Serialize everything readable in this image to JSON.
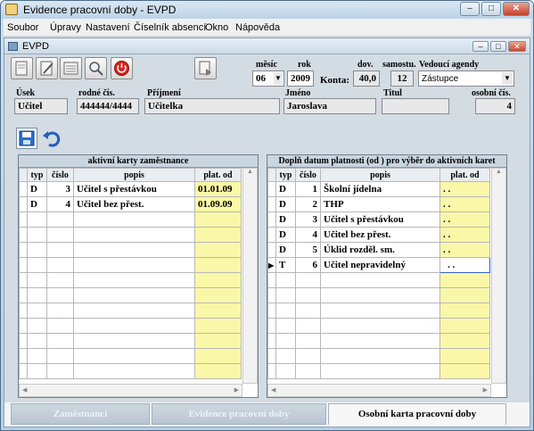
{
  "window": {
    "title": "Evidence pracovní doby - EVPD",
    "min": "–",
    "max": "□",
    "close": "✕"
  },
  "menu": [
    "Soubor",
    "Úpravy",
    "Nastavení",
    "Číselník absencí",
    "Okno",
    "Nápověda"
  ],
  "inner": {
    "title": "EVPD"
  },
  "header": {
    "mesic_label": "měsíc",
    "mesic": "06",
    "rok_label": "rok",
    "rok": "2009",
    "konta_label": "Konta:",
    "dov_label": "dov.",
    "dov": "40,0",
    "samostu_label": "samostu.",
    "samostu": "12",
    "vedouci_label": "Vedoucí agendy",
    "vedouci": "Zástupce"
  },
  "person": {
    "usek_label": "Úsek",
    "usek": "Učitel",
    "rc_label": "rodné čís.",
    "rc": "444444/4444",
    "prijmeni_label": "Příjmení",
    "prijmeni": "Učitelka",
    "jmeno_label": "Jméno",
    "jmeno": "Jaroslava",
    "titul_label": "Titul",
    "titul": "",
    "osobni_label": "osobní čís.",
    "osobni": "4"
  },
  "left_grid": {
    "title": "aktivní karty zaměstnance",
    "cols": [
      "typ",
      "číslo",
      "popis",
      "plat. od"
    ],
    "rows": [
      {
        "typ": "D",
        "cislo": "3",
        "popis": "Učitel s přestávkou",
        "plat": "01.01.09"
      },
      {
        "typ": "D",
        "cislo": "4",
        "popis": "Učitel bez přest.",
        "plat": "01.09.09"
      }
    ]
  },
  "right_grid": {
    "title": "Doplň datum platnosti (od ) pro výběr do aktivních karet",
    "cols": [
      "typ",
      "číslo",
      "popis",
      "plat. od"
    ],
    "rows": [
      {
        "typ": "D",
        "cislo": "1",
        "popis": "Školní jídelna",
        "plat": ". ."
      },
      {
        "typ": "D",
        "cislo": "2",
        "popis": "THP",
        "plat": ". ."
      },
      {
        "typ": "D",
        "cislo": "3",
        "popis": "Učitel s přestávkou",
        "plat": ". ."
      },
      {
        "typ": "D",
        "cislo": "4",
        "popis": "Učitel bez přest.",
        "plat": ". ."
      },
      {
        "typ": "D",
        "cislo": "5",
        "popis": "Úklid rozděl. sm.",
        "plat": ". ."
      },
      {
        "typ": "T",
        "cislo": "6",
        "popis": "Učitel nepravidelný",
        "plat": ". ."
      }
    ],
    "current_row_marker": "▶"
  },
  "tabs": [
    "Zaměstnanci",
    "Evidence pracovní doby",
    "Osobní karta pracovní doby"
  ],
  "icons": {
    "dropdown": "▼",
    "scroll_up": "▲",
    "scroll_down": "▼",
    "scroll_left": "◀",
    "scroll_right": "▶"
  }
}
